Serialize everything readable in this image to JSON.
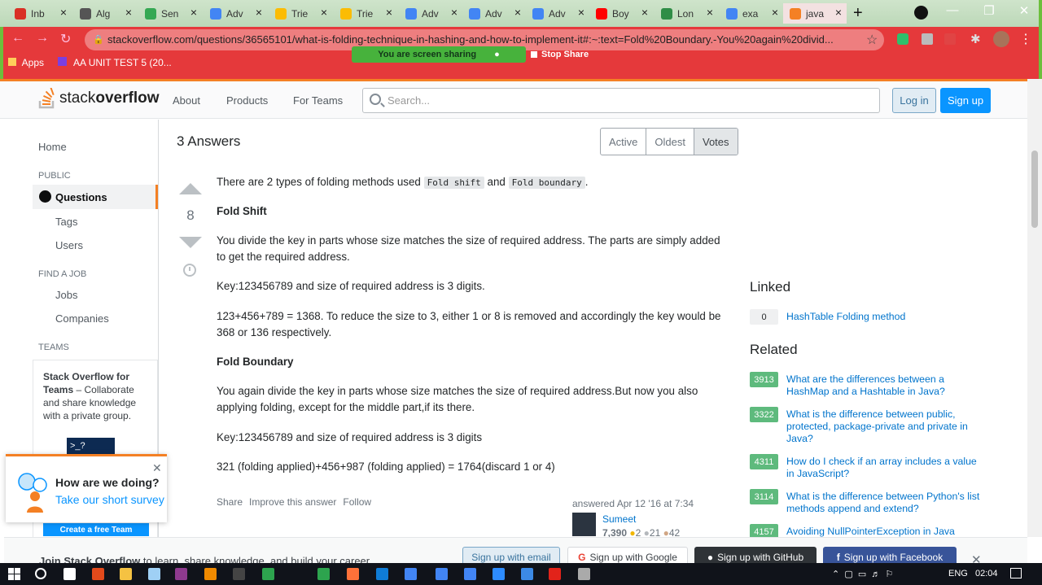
{
  "browser": {
    "tabs": [
      {
        "label": "Inb",
        "color": "#d93025"
      },
      {
        "label": "Alg",
        "color": "#555555"
      },
      {
        "label": "Sen",
        "color": "#34a853"
      },
      {
        "label": "Adv",
        "color": "#4285f4"
      },
      {
        "label": "Trie",
        "color": "#fbbc04"
      },
      {
        "label": "Trie",
        "color": "#fbbc04"
      },
      {
        "label": "Adv",
        "color": "#4285f4"
      },
      {
        "label": "Adv",
        "color": "#4285f4"
      },
      {
        "label": "Adv",
        "color": "#4285f4"
      },
      {
        "label": "Boy",
        "color": "#ff0000"
      },
      {
        "label": "Lon",
        "color": "#2f8d46"
      },
      {
        "label": "exa",
        "color": "#4285f4"
      },
      {
        "label": "java",
        "color": "#f48024"
      }
    ],
    "url": "stackoverflow.com/questions/36565101/what-is-folding-technique-in-hashing-and-how-to-implement-it#:~:text=Fold%20Boundary.-You%20again%20divid...",
    "bookmarks": [
      "Apps",
      "AA UNIT TEST 5 (20..."
    ],
    "share_notice": "You are screen sharing",
    "stop_share": "Stop Share"
  },
  "header": {
    "logo_light": "stack",
    "logo_bold": "overflow",
    "nav": [
      "About",
      "Products",
      "For Teams"
    ],
    "search_placeholder": "Search...",
    "login": "Log in",
    "signup": "Sign up"
  },
  "sidebar": {
    "home": "Home",
    "public": "PUBLIC",
    "questions": "Questions",
    "tags": "Tags",
    "users": "Users",
    "find_a_job": "FIND A JOB",
    "jobs": "Jobs",
    "companies": "Companies",
    "teams": "TEAMS",
    "teams_title": "Stack Overflow for Teams",
    "teams_desc": " – Collaborate and share knowledge with a private group.",
    "create_team": "Create a free Team"
  },
  "answers": {
    "count": "3 Answers",
    "sort": [
      "Active",
      "Oldest",
      "Votes"
    ],
    "votes": "8",
    "p1_before": "There are 2 types of folding methods used ",
    "p1_code1": "Fold shift",
    "p1_mid": " and ",
    "p1_code2": "Fold boundary",
    "p1_end": ".",
    "h1": "Fold Shift",
    "p2": "You divide the key in parts whose size matches the size of required address. The parts are simply added to get the required address.",
    "p3": "Key:123456789 and size of required address is 3 digits.",
    "p4": "123+456+789 = 1368. To reduce the size to 3, either 1 or 8 is removed and accordingly the key would be 368 or 136 respectively.",
    "h2": "Fold Boundary",
    "p5": "You again divide the key in parts whose size matches the size of required address.But now you also applying folding, except for the middle part,if its there.",
    "p6": "Key:123456789 and size of required address is 3 digits",
    "p7": "321 (folding applied)+456+987 (folding applied) = 1764(discard 1 or 4)",
    "share": "Share",
    "improve": "Improve this answer",
    "follow": "Follow",
    "answered": "answered Apr 12 '16 at 7:34",
    "user": "Sumeet",
    "rep": "7,390",
    "gold": "2",
    "silver": "21",
    "bronze": "42"
  },
  "linked": {
    "title": "Linked",
    "items": [
      {
        "score": "0",
        "text": "HashTable Folding method"
      }
    ]
  },
  "related": {
    "title": "Related",
    "items": [
      {
        "score": "3913",
        "text": "What are the differences between a HashMap and a Hashtable in Java?"
      },
      {
        "score": "3322",
        "text": "What is the difference between public, protected, package-private and private in Java?"
      },
      {
        "score": "4311",
        "text": "How do I check if an array includes a value in JavaScript?"
      },
      {
        "score": "3114",
        "text": "What is the difference between Python's list methods append and extend?"
      },
      {
        "score": "4157",
        "text": "Avoiding NullPointerException in Java"
      }
    ]
  },
  "survey": {
    "question": "How are we doing?",
    "link": "Take our short survey"
  },
  "banner": {
    "text_bold": "Join Stack Overflow",
    "text": " to learn, share knowledge, and build your career.",
    "email": "Sign up with email",
    "google": "Sign up with Google",
    "github": "Sign up with GitHub",
    "facebook": "Sign up with Facebook"
  },
  "taskbar": {
    "lang": "ENG",
    "time": "02:04"
  }
}
